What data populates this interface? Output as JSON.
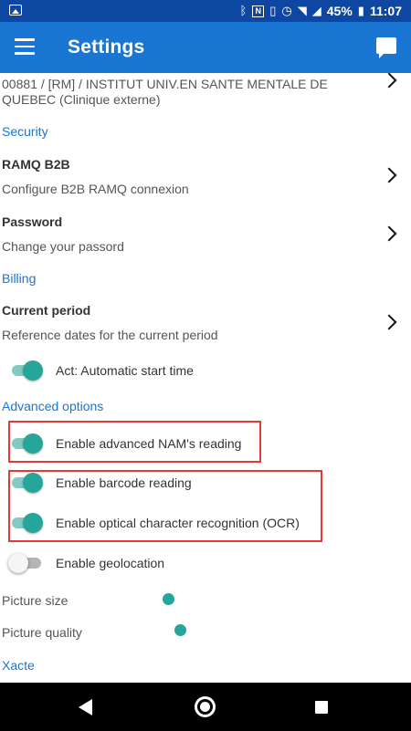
{
  "status_bar": {
    "notification_icon": "image-icon",
    "icons": [
      "bluetooth-icon",
      "nfc-icon",
      "vibrate-icon",
      "alarm-icon",
      "wifi-icon",
      "cell-signal-icon"
    ],
    "nfc_glyph": "N",
    "battery": "45%",
    "time": "11:07"
  },
  "app_bar": {
    "title": "Settings",
    "menu_icon": "hamburger-menu-icon",
    "action_icon": "chat-message-icon",
    "color": "#1976d2"
  },
  "clinic": {
    "text": "00881 / [RM] / INSTITUT UNIV.EN SANTE MENTALE DE QUEBEC (Clinique externe)"
  },
  "sections": {
    "security": "Security",
    "billing": "Billing",
    "advanced": "Advanced options",
    "xacte": "Xacte"
  },
  "security": {
    "ramq_title": "RAMQ B2B",
    "ramq_summary": "Configure B2B RAMQ connexion",
    "password_title": "Password",
    "password_summary": "Change your passord"
  },
  "billing": {
    "period_title": "Current period",
    "period_summary": "Reference dates for the current period",
    "act_label": "Act: Automatic start time",
    "act_on": true
  },
  "advanced": {
    "nam_label": "Enable advanced NAM's reading",
    "nam_on": true,
    "barcode_label": "Enable barcode reading",
    "barcode_on": true,
    "ocr_label": "Enable optical character recognition (OCR)",
    "ocr_on": true,
    "geo_label": "Enable geolocation",
    "geo_on": false,
    "picture_size_label": "Picture size",
    "picture_quality_label": "Picture quality"
  },
  "colors": {
    "accent": "#26a69a",
    "section_header": "#1976d2",
    "highlight": "#e53935"
  },
  "nav_bar": {
    "back_icon": "back-triangle-icon",
    "home_icon": "home-circle-icon",
    "recents_icon": "recents-square-icon"
  }
}
